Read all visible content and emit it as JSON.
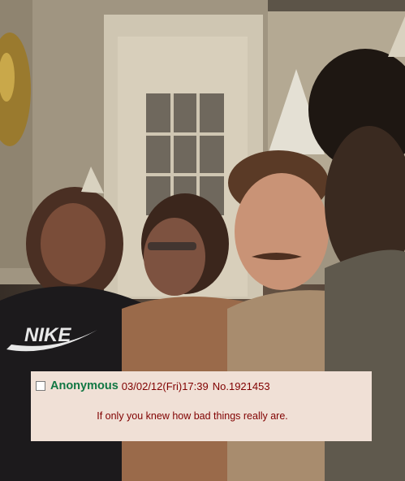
{
  "post": {
    "name": "Anonymous",
    "datetime": "03/02/12(Fri)17:39",
    "number": "No.1921453",
    "message": "If only you knew how bad things really are."
  },
  "colors": {
    "post_background": "#f0e0d6",
    "name": "#117743",
    "meta": "#800000"
  },
  "icons": [
    "post-select-checkbox"
  ]
}
